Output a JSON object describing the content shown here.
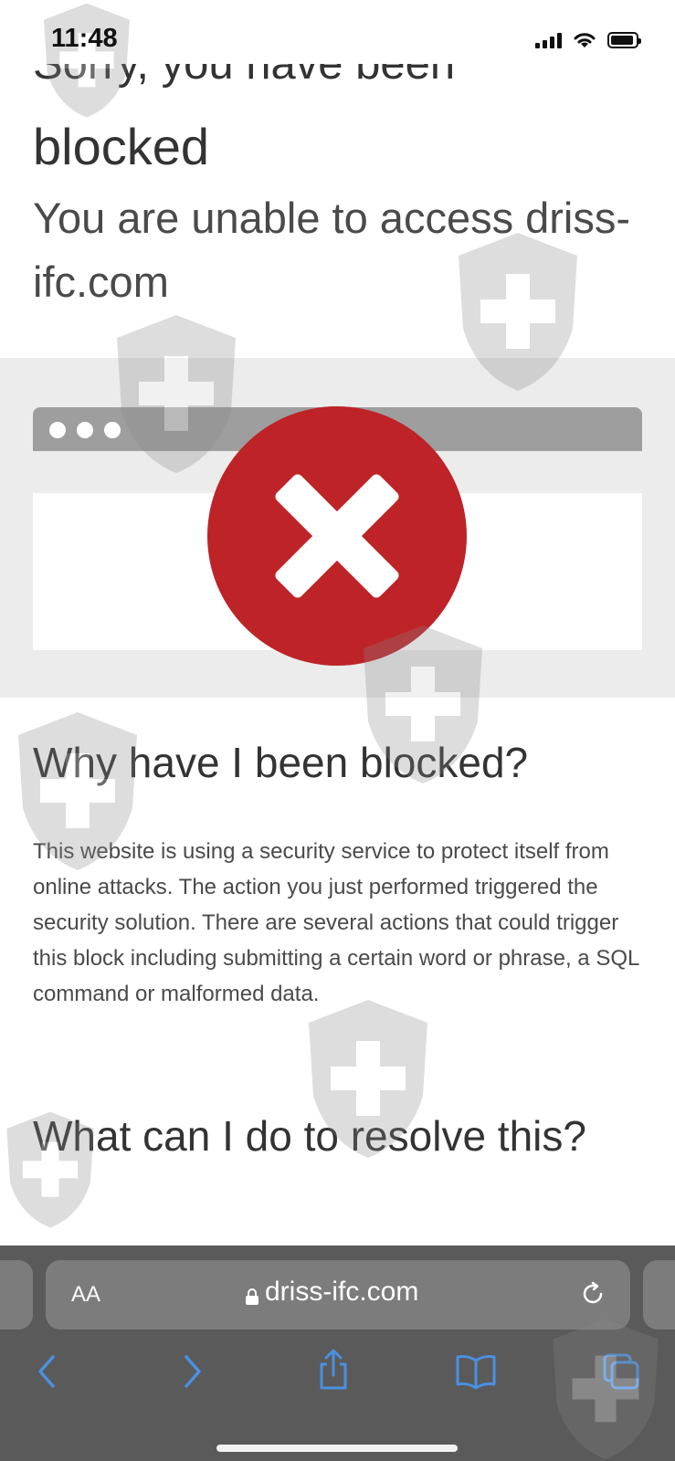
{
  "status": {
    "time": "11:48"
  },
  "page": {
    "header_clipped": "Sorry, you have been",
    "title_end": "blocked",
    "subtitle": "You are unable to access driss-ifc.com",
    "why_heading": "Why have I been blocked?",
    "why_text": "This website is using a security service to protect itself from online attacks. The action you just performed triggered the security solution. There are several actions that could trigger this block including submitting a certain word or phrase, a SQL command or malformed data.",
    "resolve_heading": "What can I do to resolve this?"
  },
  "browser": {
    "text_size_label": "AA",
    "url": "driss-ifc.com"
  },
  "colors": {
    "block_red": "#be2328",
    "toolbar_bg": "#5a5a5a",
    "link_blue": "#4a90e2"
  },
  "icons": [
    "signal-icon",
    "wifi-icon",
    "battery-icon",
    "lock-icon",
    "reload-icon",
    "back-icon",
    "forward-icon",
    "share-icon",
    "bookmarks-icon",
    "tabs-icon"
  ]
}
